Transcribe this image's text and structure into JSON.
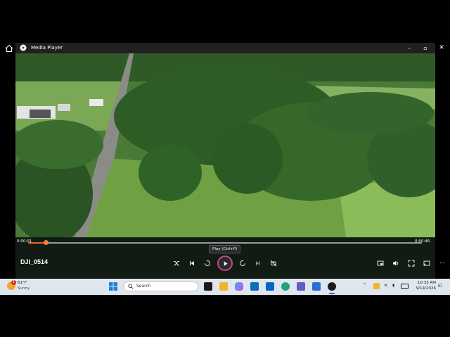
{
  "window": {
    "app_title": "Media Player",
    "minimize_icon": "minimize-icon",
    "maximize_icon": "restore-icon",
    "close_icon": "close-icon"
  },
  "player": {
    "video_title": "DJI_0514",
    "time_elapsed": "0:00:01",
    "time_total": "0:00:46",
    "progress": 0.045,
    "tooltip": "Play (Ctrl+P)",
    "controls": [
      "shuffle-icon",
      "previous-icon",
      "skip-back-10-icon",
      "play-icon",
      "skip-forward-30-icon",
      "next-icon",
      "repeat-off-icon"
    ],
    "right_controls": [
      "miniplayer-icon",
      "volume-icon",
      "fullscreen-icon",
      "cast-icon",
      "more-icon"
    ]
  },
  "taskbar": {
    "weather": {
      "badge": "1",
      "temp": "61°F",
      "condition": "Sunny"
    },
    "search_placeholder": "Search",
    "apps": [
      "task-view-icon",
      "file-explorer-icon",
      "copilot-icon",
      "store-icon",
      "outlook-icon",
      "edge-icon",
      "teams-icon",
      "snipping-icon",
      "media-player-icon"
    ],
    "clock_time": "10:33 AM",
    "clock_date": "9/14/2026"
  },
  "colors": {
    "accent": "#e8652b",
    "titlebar": "#202020",
    "taskbar": "#dfe6ee"
  }
}
